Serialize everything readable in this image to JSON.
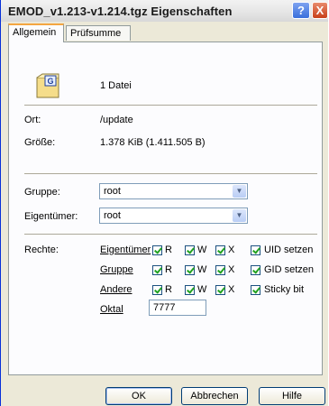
{
  "window": {
    "title": "EMOD_v1.213-v1.214.tgz Eigenschaften",
    "help_glyph": "?",
    "close_glyph": "X"
  },
  "tabs": [
    {
      "label": "Allgemein",
      "active": true
    },
    {
      "label": "Prüfsumme",
      "active": false
    }
  ],
  "file": {
    "icon": "archive-file-icon",
    "count_text": "1 Datei"
  },
  "info": {
    "location_label": "Ort:",
    "location_value": "/update",
    "size_label": "Größe:",
    "size_value": "1.378 KiB (1.411.505 B)"
  },
  "owner": {
    "group_label": "Gruppe:",
    "group_value": "root",
    "owner_label": "Eigentümer:",
    "owner_value": "root"
  },
  "rights": {
    "label": "Rechte:",
    "rows": [
      {
        "name": "Eigentümer",
        "r": "R",
        "w": "W",
        "x": "X",
        "special": "UID setzen"
      },
      {
        "name": "Gruppe",
        "r": "R",
        "w": "W",
        "x": "X",
        "special": "GID setzen"
      },
      {
        "name": "Andere",
        "r": "R",
        "w": "W",
        "x": "X",
        "special": "Sticky bit"
      }
    ],
    "octal_label": "Oktal",
    "octal_value": "7777"
  },
  "buttons": {
    "ok": "OK",
    "cancel": "Abbrechen",
    "help": "Hilfe"
  },
  "colors": {
    "title_bar": "#e6e6e6",
    "checkmark": "#21a121",
    "tab_highlight": "#f4a641"
  }
}
